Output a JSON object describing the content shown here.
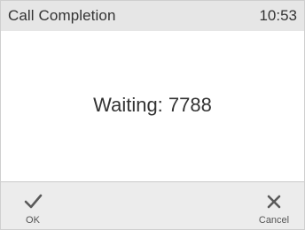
{
  "header": {
    "title": "Call Completion",
    "time": "10:53"
  },
  "main": {
    "message": "Waiting: 7788"
  },
  "softkeys": [
    {
      "label": "OK",
      "icon": "check-icon"
    },
    {
      "label": "Cancel",
      "icon": "close-icon"
    }
  ],
  "colors": {
    "header_bg": "#e6e6e6",
    "softkey_bg": "#ececec",
    "icon": "#5a5a5a",
    "text": "#333333"
  }
}
